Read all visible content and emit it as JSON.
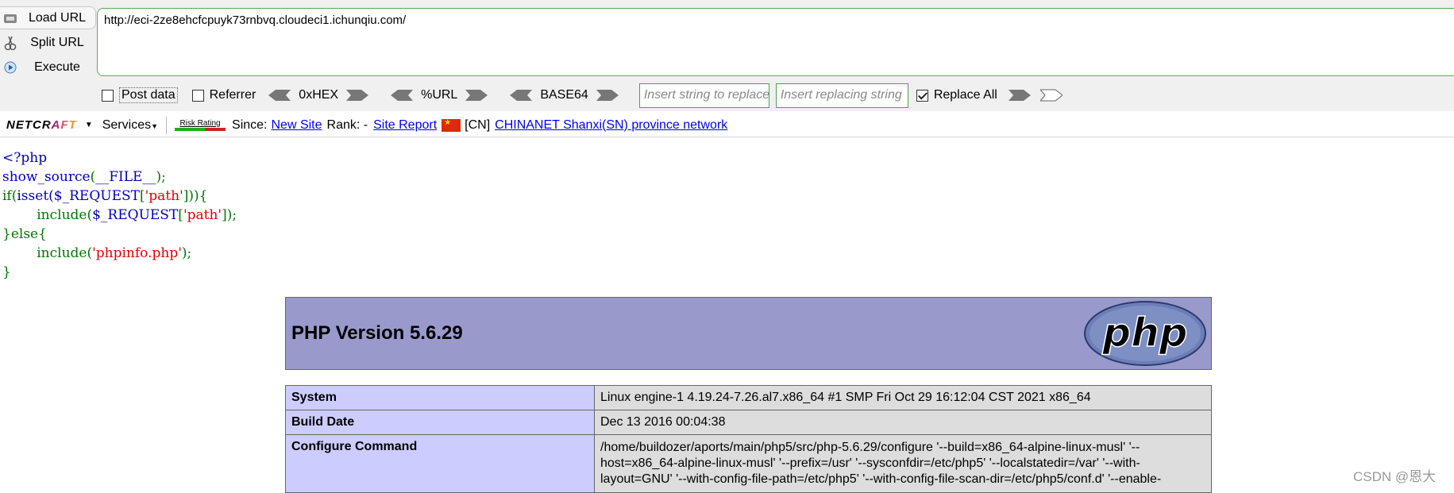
{
  "hackbar": {
    "load_url": "Load URL",
    "split_url": "Split URL",
    "execute": "Execute",
    "url": "http://eci-2ze8ehcfcpuyk73rnbvq.cloudeci1.ichunqiu.com/",
    "post_data": "Post data",
    "referrer": "Referrer",
    "hex": "0xHEX",
    "url_enc": "%URL",
    "base64": "BASE64",
    "replace_placeholder": "Insert string to replace",
    "replacing_placeholder": "Insert replacing string",
    "replace_all": "Replace All",
    "replace_all_checked": true
  },
  "netcraft": {
    "logo": "NETCRAFT",
    "services": "Services",
    "risk": "Risk Rating",
    "since_label": "Since:",
    "since_link": "New Site",
    "rank_label": "Rank: -",
    "report_link": "Site Report",
    "country": "[CN]",
    "network_link": "CHINANET Shanxi(SN) province network"
  },
  "source": {
    "l1": "<?php",
    "l2_fn": "show_source",
    "l2_open": "(",
    "l2_arg": "__FILE__",
    "l2_close": ");",
    "l3_a": "if(",
    "l3_b": "isset(",
    "l3_c": "$_REQUEST",
    "l3_d": "[",
    "l3_e": "'path'",
    "l3_f": "])){",
    "l4_a": "include(",
    "l4_b": "$_REQUEST",
    "l4_c": "[",
    "l4_d": "'path'",
    "l4_e": "]);",
    "l5": "}else{",
    "l6_a": "include(",
    "l6_b": "'phpinfo.php'",
    "l6_c": ");",
    "l7": "}"
  },
  "phpinfo": {
    "title": "PHP Version 5.6.29",
    "logo": "php",
    "rows": [
      {
        "k": "System",
        "v": "Linux engine-1 4.19.24-7.26.al7.x86_64 #1 SMP Fri Oct 29 16:12:04 CST 2021 x86_64"
      },
      {
        "k": "Build Date",
        "v": "Dec 13 2016 00:04:38"
      },
      {
        "k": "Configure Command",
        "v": "/home/buildozer/aports/main/php5/src/php-5.6.29/configure '--build=x86_64-alpine-linux-musl' '--host=x86_64-alpine-linux-musl' '--prefix=/usr' '--sysconfdir=/etc/php5' '--localstatedir=/var' '--with-layout=GNU' '--with-config-file-path=/etc/php5' '--with-config-file-scan-dir=/etc/php5/conf.d' '--enable-"
      }
    ]
  },
  "watermark": "CSDN @恩大"
}
